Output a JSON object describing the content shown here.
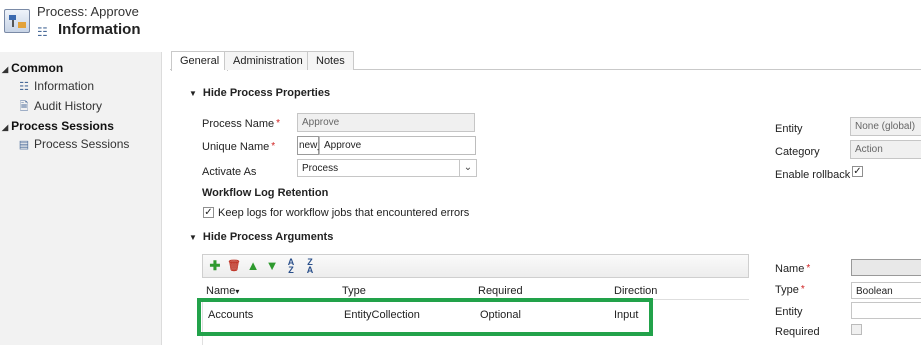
{
  "header": {
    "title": "Process: Approve",
    "subtitle": "Information"
  },
  "nav": {
    "groups": [
      {
        "label": "Common",
        "items": [
          "Information",
          "Audit History"
        ]
      },
      {
        "label": "Process Sessions",
        "items": [
          "Process Sessions"
        ]
      }
    ]
  },
  "tabs": [
    "General",
    "Administration",
    "Notes"
  ],
  "process_props": {
    "heading": "Hide Process Properties",
    "process_name_label": "Process Name",
    "process_name_value": "Approve",
    "unique_name_label": "Unique Name",
    "unique_name_prefix": "new_",
    "unique_name_value": "Approve",
    "activate_as_label": "Activate As",
    "activate_as_value": "Process",
    "log_heading": "Workflow Log Retention",
    "keep_logs_label": "Keep logs for workflow jobs that encountered errors",
    "keep_logs_checked": true
  },
  "right_props": {
    "entity_label": "Entity",
    "entity_value": "None (global)",
    "category_label": "Category",
    "category_value": "Action",
    "enable_rollback_label": "Enable rollback",
    "enable_rollback_checked": true
  },
  "arguments": {
    "heading": "Hide Process Arguments",
    "toolbar_icons": [
      "add-icon",
      "delete-icon",
      "move-up-icon",
      "move-down-icon",
      "sort-ascending-icon",
      "sort-descending-icon"
    ],
    "columns": [
      "Name",
      "Type",
      "Required",
      "Direction"
    ],
    "rows": [
      {
        "name": "Accounts",
        "type": "EntityCollection",
        "required": "Optional",
        "direction": "Input"
      }
    ]
  },
  "arg_detail": {
    "name_label": "Name",
    "type_label": "Type",
    "type_value": "Boolean",
    "entity_label": "Entity",
    "required_label": "Required"
  },
  "colors": {
    "highlight": "#22a24a",
    "required_star": "#d02020",
    "add_icon": "#2e9a2e"
  }
}
